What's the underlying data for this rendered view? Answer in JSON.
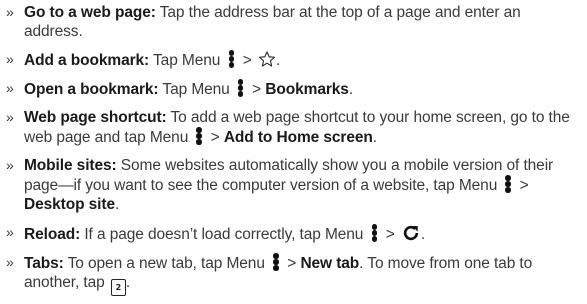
{
  "bullet_glyph": "»",
  "items": [
    {
      "title": "Go to a web page:",
      "text": " Tap the address bar at the top of a page and enter an address."
    },
    {
      "title": "Add a bookmark:",
      "pre": " Tap Menu ",
      "sep": " > ",
      "post": ".",
      "icon": "star-icon"
    },
    {
      "title": "Open a bookmark:",
      "pre": " Tap Menu ",
      "sep": " > ",
      "action": "Bookmarks",
      "post": "."
    },
    {
      "title": "Web page shortcut:",
      "pre": " To add a web page shortcut to your home screen, go to the web page and tap Menu ",
      "sep": " > ",
      "action": "Add to Home screen",
      "post": "."
    },
    {
      "title": "Mobile sites:",
      "pre": " Some websites automatically show you a mobile version of their page—if you want to see the computer version of a website, tap Menu ",
      "sep": " > ",
      "action": "Desktop site",
      "post": "."
    },
    {
      "title": "Reload:",
      "pre": " If a page doesn’t load correctly, tap Menu ",
      "sep": " > ",
      "post": ".",
      "icon": "reload-icon"
    },
    {
      "title": "Tabs:",
      "pre": " To open a new tab, tap Menu ",
      "sep": " > ",
      "action": "New tab",
      "mid": ". To move from one tab to another, tap ",
      "tab_count": "2",
      "post": "."
    }
  ]
}
